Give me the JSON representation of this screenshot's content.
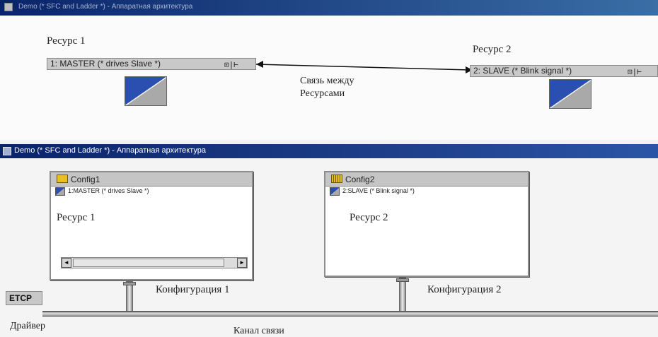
{
  "top_window": {
    "title": "Demo (* SFC and Ladder *) - Аппаратная архитектура"
  },
  "resources_view": {
    "resource1": {
      "label": "Ресурс 1",
      "bar": "1: MASTER (* drives Slave *)",
      "buttons": "⊡|⊢"
    },
    "resource2": {
      "label": "Ресурс 2",
      "bar": "2: SLAVE (* Blink signal *)",
      "buttons": "⊡|⊢"
    },
    "link_caption_line1": "Связь между",
    "link_caption_line2": "Ресурсами"
  },
  "bottom_window": {
    "title": "Demo (* SFC and Ladder *) - Аппаратная архитектура"
  },
  "config1": {
    "name": "Config1",
    "resource_line": "1:MASTER (* drives Slave *)",
    "body": "Ресурс 1",
    "caption": "Конфигурация 1"
  },
  "config2": {
    "name": "Config2",
    "resource_line": "2:SLAVE (* Blink signal *)",
    "body": "Ресурс 2",
    "caption": "Конфигурация 2"
  },
  "network": {
    "label": "ETCP",
    "driver": "Драйвер",
    "channel": "Канал связи"
  },
  "scroll": {
    "left": "◄",
    "right": "►"
  }
}
